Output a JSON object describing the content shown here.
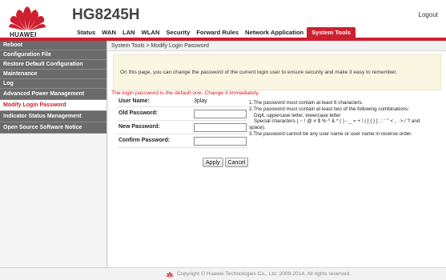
{
  "brand": {
    "logo_text": "HUAWEI",
    "model": "HG8245H",
    "accent": "#cf1f2e"
  },
  "header": {
    "logout": "Logout"
  },
  "nav": [
    {
      "label": "Status"
    },
    {
      "label": "WAN"
    },
    {
      "label": "LAN"
    },
    {
      "label": "WLAN"
    },
    {
      "label": "Security"
    },
    {
      "label": "Forward Rules"
    },
    {
      "label": "Network Application"
    },
    {
      "label": "System Tools",
      "active": true
    }
  ],
  "sidebar": [
    {
      "label": "Reboot"
    },
    {
      "label": "Configuration File"
    },
    {
      "label": "Restore Default Configuration"
    },
    {
      "label": "Maintenance"
    },
    {
      "label": "Log"
    },
    {
      "label": "Advanced Power Management"
    },
    {
      "label": "Modify Login Password",
      "active": true
    },
    {
      "label": "Indicator Status Management"
    },
    {
      "label": "Open Source Software Notice"
    }
  ],
  "breadcrumb": "System Tools > Modify Login Password",
  "info": "On this page, you can change the password of the current login user to ensure security and make it easy to remember.",
  "warning": "The login password is the default one. Change it immediately.",
  "form": {
    "username_label": "User Name:",
    "username_value": "3play",
    "old_label": "Old Password:",
    "new_label": "New Password:",
    "confirm_label": "Confirm Password:",
    "old_value": "",
    "new_value": "",
    "confirm_value": ""
  },
  "rules": {
    "r1": "1.The password must contain at least 6 characters.",
    "r2": "2.The password must contain at least two of the following combinations:",
    "r2a": "Digit, uppercase letter, lowercase letter",
    "r2b": "Special characters ( ~ ! @ # $ % ^ & * ( ) - _ = + \\ | [ { } ] ; : ' \" < , . > / ? and",
    "r2c": "space).",
    "r3": "3.The password cannot be any user name or user name in reverse order."
  },
  "buttons": {
    "apply": "Apply",
    "cancel": "Cancel"
  },
  "footer": "Copyright © Huawei Technologies Co., Ltd. 2009-2014. All rights reserved."
}
